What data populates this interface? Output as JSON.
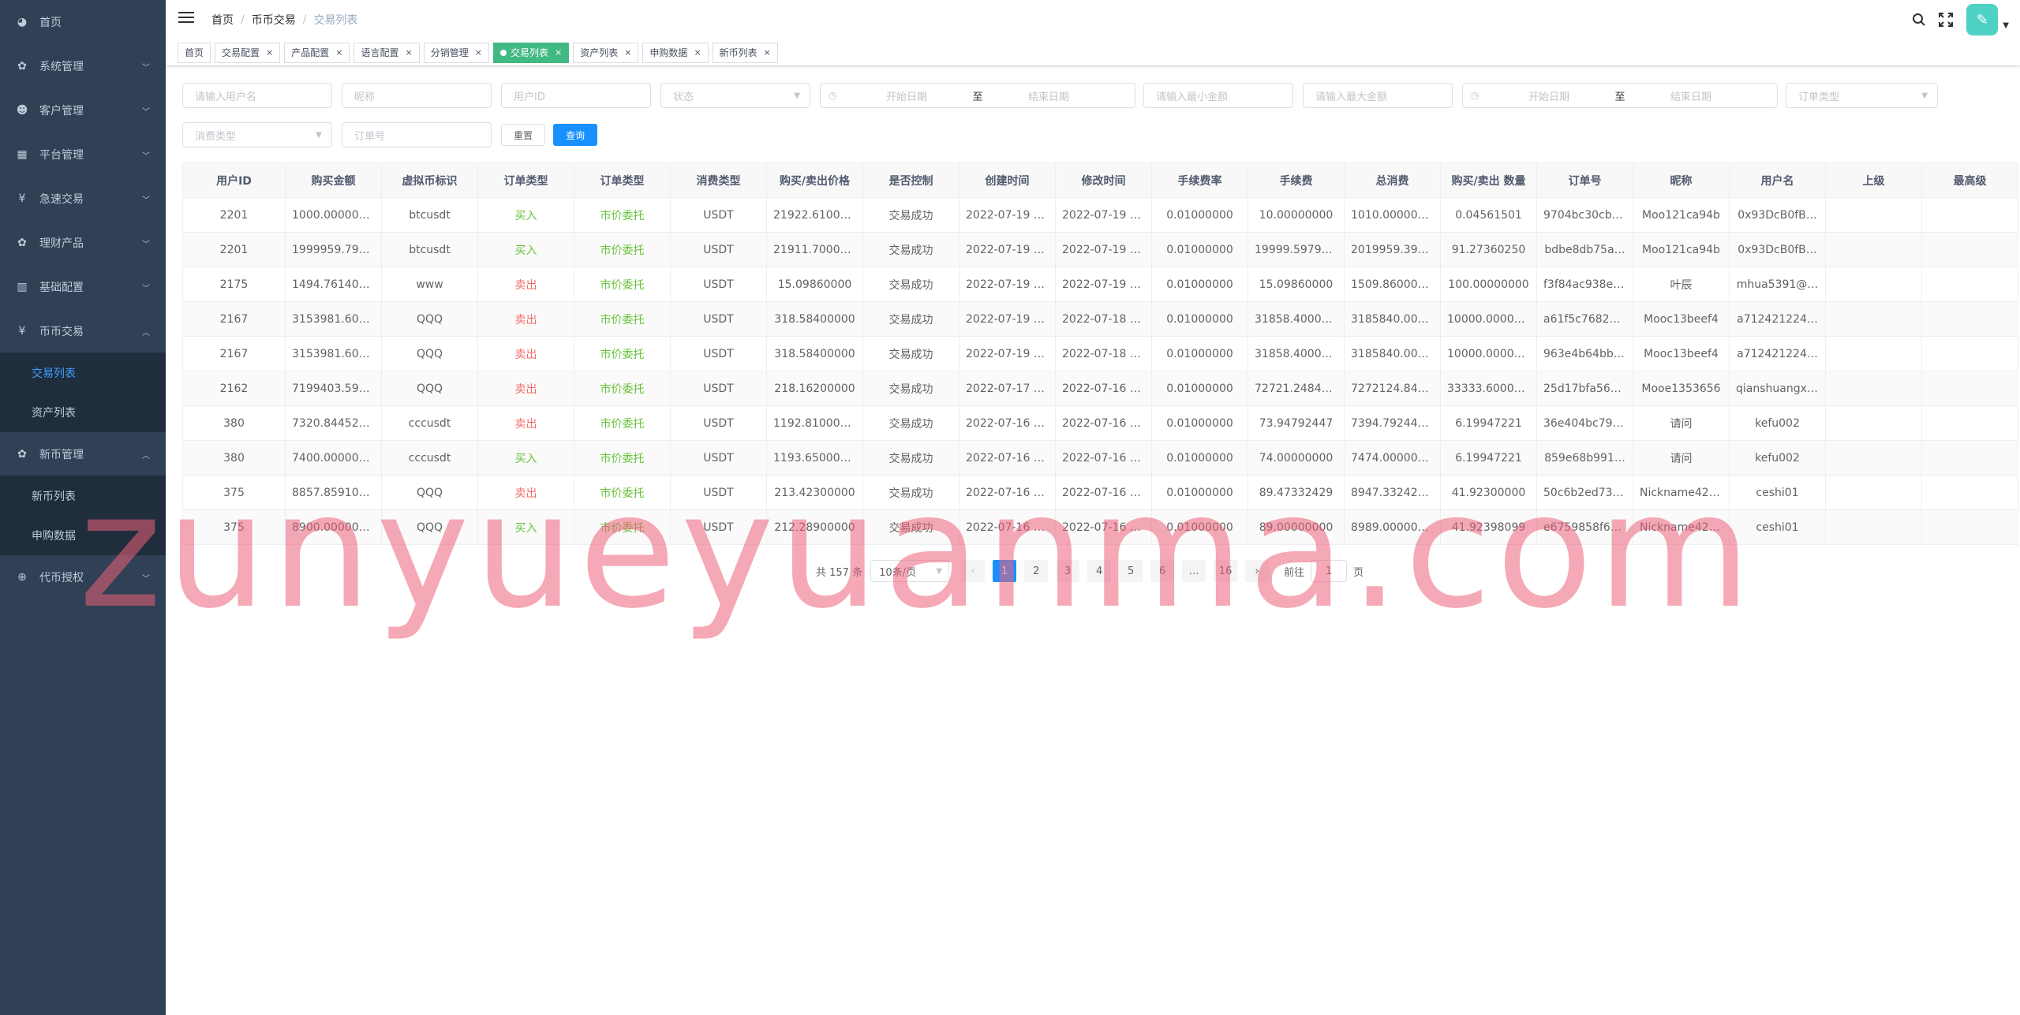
{
  "sidebar": {
    "items": [
      {
        "icon": "dashboard-icon",
        "glyph": "◕",
        "label": "首页",
        "arrow": false
      },
      {
        "icon": "gear-icon",
        "glyph": "✿",
        "label": "系统管理",
        "arrow": true
      },
      {
        "icon": "user-group-icon",
        "glyph": "☻",
        "label": "客户管理",
        "arrow": true
      },
      {
        "icon": "grid-icon",
        "glyph": "▦",
        "label": "平台管理",
        "arrow": true
      },
      {
        "icon": "yen-icon",
        "glyph": "¥",
        "label": "急速交易",
        "arrow": true
      },
      {
        "icon": "product-icon",
        "glyph": "✿",
        "label": "理财产品",
        "arrow": true
      },
      {
        "icon": "book-icon",
        "glyph": "▥",
        "label": "基础配置",
        "arrow": true
      },
      {
        "icon": "yen-icon",
        "glyph": "¥",
        "label": "币币交易",
        "arrow": "up"
      },
      {
        "icon": "gear-icon",
        "glyph": "✿",
        "label": "新币管理",
        "arrow": "up"
      },
      {
        "icon": "coin-icon",
        "glyph": "⊕",
        "label": "代币授权",
        "arrow": true
      }
    ],
    "coin_trade_sub": [
      {
        "label": "交易列表",
        "active": true
      },
      {
        "label": "资产列表",
        "active": false
      }
    ],
    "new_coin_sub": [
      {
        "label": "新币列表"
      },
      {
        "label": "申购数据"
      }
    ]
  },
  "navbar": {
    "breadcrumb": [
      "首页",
      "币币交易",
      "交易列表"
    ]
  },
  "tags": [
    {
      "label": "首页",
      "closable": false,
      "active": false
    },
    {
      "label": "交易配置",
      "closable": true,
      "active": false
    },
    {
      "label": "产品配置",
      "closable": true,
      "active": false
    },
    {
      "label": "语言配置",
      "closable": true,
      "active": false
    },
    {
      "label": "分销管理",
      "closable": true,
      "active": false
    },
    {
      "label": "交易列表",
      "closable": true,
      "active": true
    },
    {
      "label": "资产列表",
      "closable": true,
      "active": false
    },
    {
      "label": "申购数据",
      "closable": true,
      "active": false
    },
    {
      "label": "新币列表",
      "closable": true,
      "active": false
    }
  ],
  "filters": {
    "username_placeholder": "请输入用户名",
    "nickname_placeholder": "昵称",
    "userid_placeholder": "用户ID",
    "status_placeholder": "状态",
    "date_start": "开始日期",
    "date_sep": "至",
    "date_end": "结束日期",
    "min_amount_placeholder": "请输入最小金额",
    "max_amount_placeholder": "请输入最大金额",
    "order_type_placeholder": "订单类型",
    "consume_type_placeholder": "消费类型",
    "order_no_placeholder": "订单号",
    "reset_label": "重置",
    "search_label": "查询"
  },
  "table": {
    "headers": [
      "用户ID",
      "购买金额",
      "虚拟币标识",
      "订单类型",
      "订单类型",
      "消费类型",
      "购买/卖出价格",
      "是否控制",
      "创建时间",
      "修改时间",
      "手续费率",
      "手续费",
      "总消费",
      "购买/卖出 数量",
      "订单号",
      "昵称",
      "用户名",
      "上级",
      "最高级"
    ],
    "rows": [
      [
        "2201",
        "1000.00000000",
        "btcusdt",
        "买入",
        "市价委托",
        "USDT",
        "21922.61000…",
        "交易成功",
        "2022-07-19 1…",
        "2022-07-19 0…",
        "0.01000000",
        "10.00000000",
        "1010.00000000",
        "0.04561501",
        "9704bc30cb6…",
        "Moo121ca94b",
        "0x93DcB0fB…",
        "",
        ""
      ],
      [
        "2201",
        "1999959.796…",
        "btcusdt",
        "买入",
        "市价委托",
        "USDT",
        "21911.70000…",
        "交易成功",
        "2022-07-19 1…",
        "2022-07-19 0…",
        "0.01000000",
        "19999.59796…",
        "2019959.393…",
        "91.27360250",
        "bdbe8db75a…",
        "Moo121ca94b",
        "0x93DcB0fB…",
        "",
        ""
      ],
      [
        "2175",
        "1494.76140000",
        "www",
        "卖出",
        "市价委托",
        "USDT",
        "15.09860000",
        "交易成功",
        "2022-07-19 1…",
        "2022-07-19 0…",
        "0.01000000",
        "15.09860000",
        "1509.86000000",
        "100.00000000",
        "f3f84ac938ee…",
        "叶辰",
        "mhua5391@…",
        "",
        ""
      ],
      [
        "2167",
        "3153981.600…",
        "QQQ",
        "卖出",
        "市价委托",
        "USDT",
        "318.58400000",
        "交易成功",
        "2022-07-19 0…",
        "2022-07-18 1…",
        "0.01000000",
        "31858.40000…",
        "3185840.000…",
        "10000.00000…",
        "a61f5c7682d…",
        "Mooc13beef4",
        "a712421224…",
        "",
        ""
      ],
      [
        "2167",
        "3153981.600…",
        "QQQ",
        "卖出",
        "市价委托",
        "USDT",
        "318.58400000",
        "交易成功",
        "2022-07-19 0…",
        "2022-07-18 1…",
        "0.01000000",
        "31858.40000…",
        "3185840.000…",
        "10000.00000…",
        "963e4b64bbc…",
        "Mooc13beef4",
        "a712421224…",
        "",
        ""
      ],
      [
        "2162",
        "7199403.594…",
        "QQQ",
        "卖出",
        "市价委托",
        "USDT",
        "218.16200000",
        "交易成功",
        "2022-07-17 0…",
        "2022-07-16 1…",
        "0.01000000",
        "72721.24843…",
        "7272124.843…",
        "33333.60000…",
        "25d17bfa56e…",
        "Mooe1353656",
        "qianshuangxi…",
        "",
        ""
      ],
      [
        "380",
        "7320.84452234",
        "cccusdt",
        "卖出",
        "市价委托",
        "USDT",
        "1192.81000000",
        "交易成功",
        "2022-07-16 1…",
        "2022-07-16 0…",
        "0.01000000",
        "73.94792447",
        "7394.79244681",
        "6.19947221",
        "36e404bc79a…",
        "请问",
        "kefu002",
        "",
        ""
      ],
      [
        "380",
        "7400.00000000",
        "cccusdt",
        "买入",
        "市价委托",
        "USDT",
        "1193.65000000",
        "交易成功",
        "2022-07-16 1…",
        "2022-07-16 0…",
        "0.01000000",
        "74.00000000",
        "7474.00000000",
        "6.19947221",
        "859e68b991…",
        "请问",
        "kefu002",
        "",
        ""
      ],
      [
        "375",
        "8857.85910471",
        "QQQ",
        "卖出",
        "市价委托",
        "USDT",
        "213.42300000",
        "交易成功",
        "2022-07-16 1…",
        "2022-07-16 0…",
        "0.01000000",
        "89.47332429",
        "8947.33242900",
        "41.92300000",
        "50c6b2ed73f…",
        "Nickname4294",
        "ceshi01",
        "",
        ""
      ],
      [
        "375",
        "8900.00000000",
        "QQQ",
        "买入",
        "市价委托",
        "USDT",
        "212.28900000",
        "交易成功",
        "2022-07-16 1…",
        "2022-07-16 0…",
        "0.01000000",
        "89.00000000",
        "8989.00000000",
        "41.92398099",
        "e6759858f6a…",
        "Nickname4294",
        "ceshi01",
        "",
        ""
      ]
    ]
  },
  "pagination": {
    "total_text": "共 157 条",
    "page_size": "10条/页",
    "pages": [
      "1",
      "2",
      "3",
      "4",
      "5",
      "6",
      "…",
      "16"
    ],
    "current_page": "1",
    "goto_label": "前往",
    "goto_value": "1",
    "page_suffix": "页"
  },
  "watermark": "zunyueyuanma.com",
  "colors": {
    "sidebar_bg": "#304156",
    "submenu_bg": "#1f2d3d",
    "accent": "#1890ff",
    "active_tag": "#42b983",
    "buy": "#67c23a",
    "sell": "#f56c6c"
  }
}
